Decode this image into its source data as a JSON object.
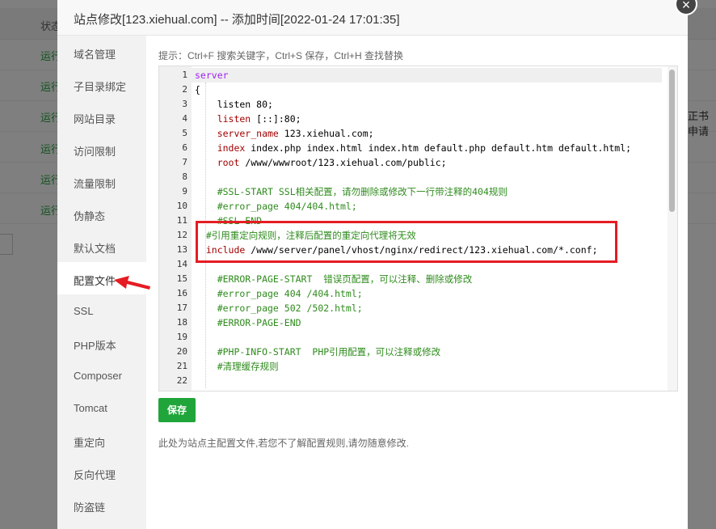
{
  "background": {
    "header_label": "状态",
    "statuses": [
      "运行",
      "运行",
      "运行",
      "运行",
      "运行",
      "运行"
    ],
    "right_cut_text": "正书申请"
  },
  "modal": {
    "title": "站点修改[123.xiehual.com] -- 添加时间[2022-01-24 17:01:35]",
    "close_glyph": "×"
  },
  "sidebar": {
    "items": [
      {
        "label": "域名管理"
      },
      {
        "label": "子目录绑定"
      },
      {
        "label": "网站目录"
      },
      {
        "label": "访问限制"
      },
      {
        "label": "流量限制"
      },
      {
        "label": "伪静态"
      },
      {
        "label": "默认文档"
      },
      {
        "label": "配置文件"
      },
      {
        "label": "SSL"
      },
      {
        "label": "PHP版本"
      },
      {
        "label": "Composer"
      },
      {
        "label": "Tomcat"
      },
      {
        "label": "重定向"
      },
      {
        "label": "反向代理"
      },
      {
        "label": "防盗链"
      }
    ],
    "active_index": 7
  },
  "editor": {
    "tip": "提示：Ctrl+F 搜索关键字，Ctrl+S 保存，Ctrl+H 查找替换",
    "line_numbers": [
      "1",
      "2",
      "3",
      "4",
      "5",
      "6",
      "7",
      "8",
      "9",
      "10",
      "11",
      "12",
      "13",
      "14",
      "15",
      "16",
      "17",
      "18",
      "19",
      "20",
      "21",
      "22"
    ],
    "lines": [
      {
        "kw": "server",
        "rest": ""
      },
      {
        "kw": "",
        "rest": "{"
      },
      {
        "kw": "",
        "rest": "    listen 80;"
      },
      {
        "kw": "    listen",
        "rest": " [::]:80;"
      },
      {
        "kw": "    server_name",
        "rest": " 123.xiehual.com;"
      },
      {
        "kw": "    index",
        "rest": " index.php index.html index.htm default.php default.htm default.html;"
      },
      {
        "kw": "    root",
        "rest": " /www/wwwroot/123.xiehual.com/public;"
      },
      {
        "kw": "",
        "rest": ""
      },
      {
        "cmt": "    #SSL-START SSL相关配置，请勿删除或修改下一行带注释的404规则"
      },
      {
        "cmt": "    #error_page 404/404.html;"
      },
      {
        "cmt": "    #SSL-END"
      },
      {
        "cmt": "  #引用重定向规则，注释后配置的重定向代理将无效"
      },
      {
        "kw": "  include",
        "rest": " /www/server/panel/vhost/nginx/redirect/123.xiehual.com/*.conf;"
      },
      {
        "kw": "",
        "rest": ""
      },
      {
        "cmt": "    #ERROR-PAGE-START  错误页配置，可以注释、删除或修改"
      },
      {
        "cmt": "    #error_page 404 /404.html;"
      },
      {
        "cmt": "    #error_page 502 /502.html;"
      },
      {
        "cmt": "    #ERROR-PAGE-END"
      },
      {
        "kw": "",
        "rest": ""
      },
      {
        "cmt": "    #PHP-INFO-START  PHP引用配置，可以注释或修改"
      },
      {
        "cmt": "    #清理缓存规则"
      },
      {
        "kw": "",
        "rest": ""
      }
    ],
    "save_label": "保存",
    "note": "此处为站点主配置文件,若您不了解配置规则,请勿随意修改."
  },
  "colors": {
    "green": "#20a53a",
    "highlight_red": "#e51c23",
    "keyword": "#a020f0",
    "comment": "#2e8b1c"
  }
}
